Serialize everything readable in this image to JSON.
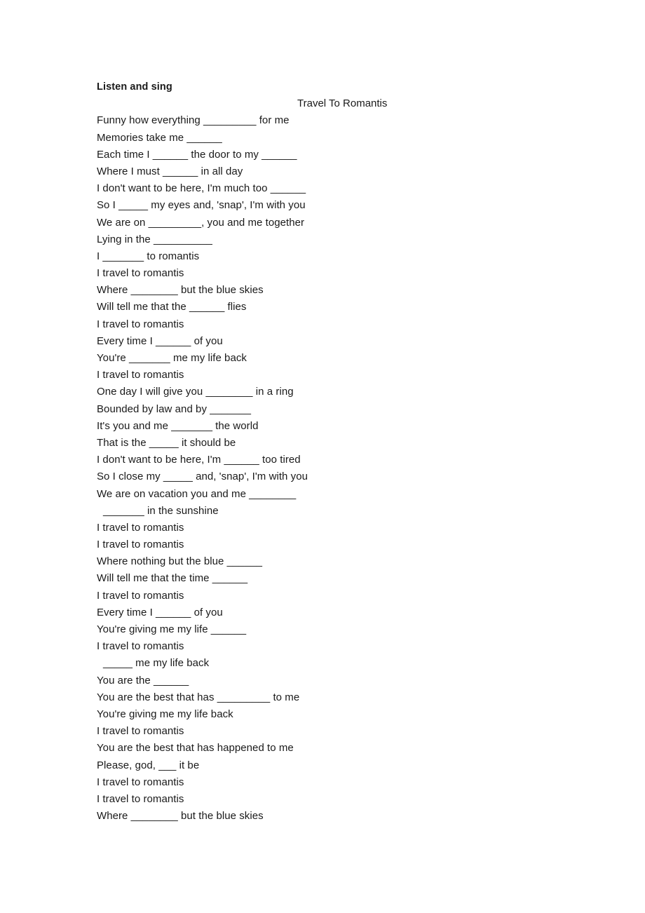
{
  "document": {
    "heading": "Listen and sing",
    "song_title": "Travel To Romantis",
    "lyrics": [
      {
        "text": "Funny how everything _________ for me",
        "indented": false
      },
      {
        "text": "Memories take me ______",
        "indented": false
      },
      {
        "text": "Each time I ______ the door to my ______",
        "indented": false
      },
      {
        "text": "Where I must ______ in all day",
        "indented": false
      },
      {
        "text": "I don't want to be here, I'm much too ______",
        "indented": false
      },
      {
        "text": "So I _____ my eyes and, 'snap', I'm with you",
        "indented": false
      },
      {
        "text": "We are on _________, you and me together",
        "indented": false
      },
      {
        "text": "Lying in the __________",
        "indented": false
      },
      {
        "text": "I _______ to romantis",
        "indented": false
      },
      {
        "text": "I travel to romantis",
        "indented": false
      },
      {
        "text": "Where ________ but the blue skies",
        "indented": false
      },
      {
        "text": "Will tell me that the ______ flies",
        "indented": false
      },
      {
        "text": "I travel to romantis",
        "indented": false
      },
      {
        "text": "Every time I ______ of you",
        "indented": false
      },
      {
        "text": "You're _______ me my life back",
        "indented": false
      },
      {
        "text": "I travel to romantis",
        "indented": false
      },
      {
        "text": "One day I will give you ________ in a ring",
        "indented": false
      },
      {
        "text": "Bounded by law and by _______",
        "indented": false
      },
      {
        "text": "It's you and me _______ the world",
        "indented": false
      },
      {
        "text": "That is the _____ it should be",
        "indented": false
      },
      {
        "text": "I don't want to be here, I'm ______ too tired",
        "indented": false
      },
      {
        "text": "So I close my _____ and, 'snap', I'm with you",
        "indented": false
      },
      {
        "text": "We are on vacation you and me ________",
        "indented": false
      },
      {
        "text": "_______ in the sunshine",
        "indented": true
      },
      {
        "text": "I travel to romantis",
        "indented": false
      },
      {
        "text": "I travel to romantis",
        "indented": false
      },
      {
        "text": "Where nothing but the blue ______",
        "indented": false
      },
      {
        "text": "Will tell me that the time ______",
        "indented": false
      },
      {
        "text": "I travel to romantis",
        "indented": false
      },
      {
        "text": "Every time I ______ of you",
        "indented": false
      },
      {
        "text": "You're giving me my life ______",
        "indented": false
      },
      {
        "text": "I travel to romantis",
        "indented": false
      },
      {
        "text": "_____ me my life back",
        "indented": true
      },
      {
        "text": "You are the ______",
        "indented": false
      },
      {
        "text": "You are the best that has _________ to me",
        "indented": false
      },
      {
        "text": "You're giving me my life back",
        "indented": false
      },
      {
        "text": "I travel to romantis",
        "indented": false
      },
      {
        "text": "You are the best that has happened to me",
        "indented": false
      },
      {
        "text": "Please, god, ___ it be",
        "indented": false
      },
      {
        "text": "I travel to romantis",
        "indented": false
      },
      {
        "text": "I travel to romantis",
        "indented": false
      },
      {
        "text": "Where ________ but the blue skies",
        "indented": false
      }
    ]
  }
}
